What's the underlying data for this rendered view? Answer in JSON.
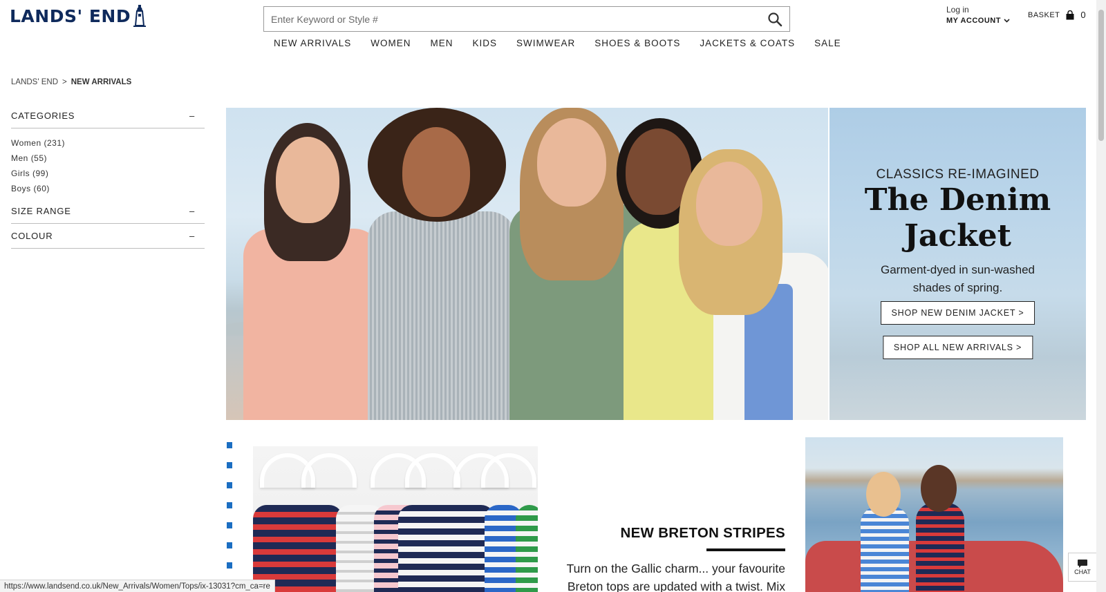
{
  "brand": {
    "logo_text": "LANDS' END"
  },
  "search": {
    "placeholder": "Enter Keyword or Style #"
  },
  "account": {
    "login_label": "Log in",
    "my_account_label": "MY ACCOUNT"
  },
  "basket": {
    "label": "BASKET",
    "count": "0"
  },
  "nav": [
    "NEW ARRIVALS",
    "WOMEN",
    "MEN",
    "KIDS",
    "SWIMWEAR",
    "SHOES & BOOTS",
    "JACKETS & COATS",
    "SALE"
  ],
  "breadcrumb": {
    "home": "LANDS' END",
    "separator": ">",
    "current": "NEW ARRIVALS"
  },
  "sidebar": {
    "categories": {
      "title": "CATEGORIES",
      "toggle": "–",
      "items": [
        {
          "label": "Women",
          "count": "(231)"
        },
        {
          "label": "Men",
          "count": "(55)"
        },
        {
          "label": "Girls",
          "count": "(99)"
        },
        {
          "label": "Boys",
          "count": "(60)"
        }
      ]
    },
    "size_range": {
      "title": "SIZE RANGE",
      "toggle": "–"
    },
    "colour": {
      "title": "COLOUR",
      "toggle": "–"
    }
  },
  "hero": {
    "kicker": "CLASSICS RE-IMAGINED",
    "title_line1": "The Denim",
    "title_line2": "Jacket",
    "subtitle": "Garment-dyed in sun-washed shades of spring.",
    "button_primary": "SHOP NEW DENIM JACKET >",
    "button_secondary": "SHOP ALL NEW ARRIVALS >"
  },
  "promo": {
    "title": "NEW BRETON STRIPES",
    "text": "Turn on the Gallic charm... your favourite Breton tops are updated with a twist. Mix"
  },
  "chat": {
    "label": "CHAT"
  },
  "status_url": "https://www.landsend.co.uk/New_Arrivals/Women/Tops/ix-13031?cm_ca=re",
  "colors": {
    "brand_navy": "#0f2a5c",
    "dot_blue": "#1b6ec2"
  }
}
